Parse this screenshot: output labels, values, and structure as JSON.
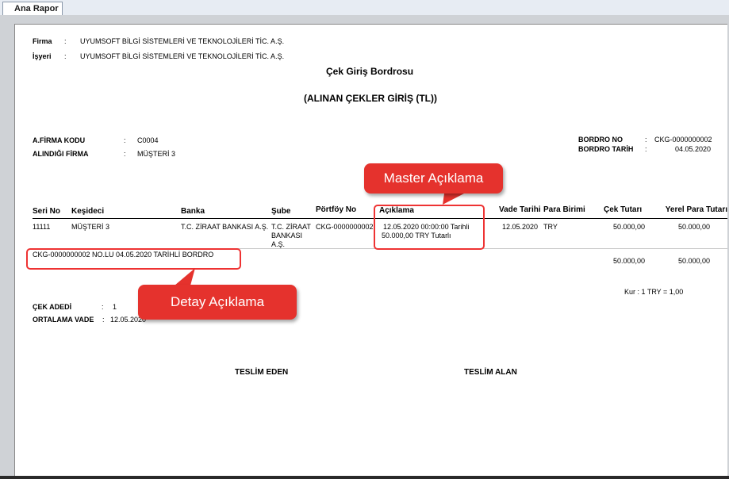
{
  "tab": {
    "label": "Ana Rapor"
  },
  "report": {
    "firma_label": "Firma",
    "firma_value": "UYUMSOFT BİLGİ SİSTEMLERİ VE TEKNOLOJİLERİ TİC. A.Ş.",
    "isyeri_label": "İşyeri",
    "isyeri_value": "UYUMSOFT BİLGİ SİSTEMLERİ VE TEKNOLOJİLERİ TİC. A.Ş.",
    "colon": ":",
    "title": "Çek Giriş Bordrosu",
    "subtitle": "(ALINAN ÇEKLER GİRİŞ (TL))",
    "firma_kodu_label": "A.FİRMA KODU",
    "firma_kodu_value": "C0004",
    "alindigi_firma_label": "ALINDIĞI FİRMA",
    "alindigi_firma_value": "MÜŞTERİ 3",
    "bordro_no_label": "BORDRO NO",
    "bordro_no_value": "CKG-0000000002",
    "bordro_tarih_label": "BORDRO TARİH",
    "bordro_tarih_value": "04.05.2020",
    "columns": {
      "seri_no": "Seri No",
      "kesideci": "Keşideci",
      "banka": "Banka",
      "sube": "Şube",
      "portfoy_no": "Pörtföy No",
      "aciklama": "Açıklama",
      "vade_tarihi": "Vade Tarihi",
      "para_birimi": "Para Birimi",
      "cek_tutari": "Çek Tutarı",
      "yerel_para": "Yerel Para Tutarı"
    },
    "row": {
      "seri_no": "11111",
      "kesideci": "MÜŞTERİ 3",
      "banka": "T.C. ZİRAAT BANKASI A.Ş.",
      "sube_line1": "T.C. ZİRAAT",
      "sube_line2": "BANKASI",
      "sube_line3": "A.Ş.",
      "portfoy_no": "CKG-0000000002",
      "aciklama_line1": "12.05.2020  00:00:00 Tarihli",
      "aciklama_line2": "50.000,00 TRY Tutarlı",
      "vade_tarihi": "12.05.2020",
      "para_birimi": "TRY",
      "cek_tutari": "50.000,00",
      "yerel_para": "50.000,00"
    },
    "detail_note": "CKG-0000000002 NO.LU 04.05.2020 TARİHLİ BORDRO",
    "total_cek": "50.000,00",
    "total_yerel": "50.000,00",
    "kur": "Kur : 1 TRY = 1,00",
    "cek_adedi_label": "ÇEK ADEDİ",
    "cek_adedi_value": "1",
    "ortalama_vade_label": "ORTALAMA VADE",
    "ortalama_vade_value": "12.05.2020",
    "teslim_eden": "TESLİM EDEN",
    "teslim_alan": "TESLİM ALAN"
  },
  "callouts": {
    "master": "Master Açıklama",
    "detay": "Detay Açıklama"
  },
  "colors": {
    "callout": "#e5322d",
    "tab_bg": "#e7ecf3",
    "frame": "#cfd2d6"
  }
}
